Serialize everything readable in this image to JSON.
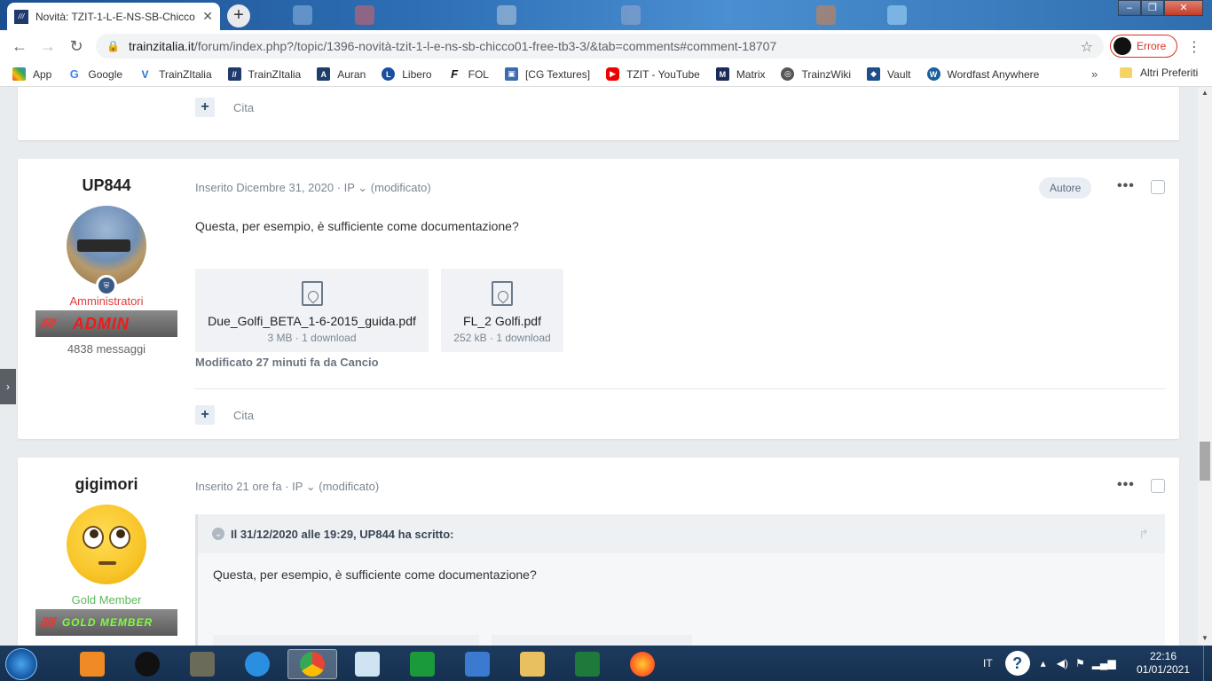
{
  "browser": {
    "tab_title": "Novità: TZIT-1-L-E-NS-SB-Chicco",
    "url_host": "trainzitalia.it",
    "url_path": "/forum/index.php?/topic/1396-novità-tzit-1-l-e-ns-sb-chicco01-free-tb3-3/&tab=comments#comment-18707",
    "profile_status": "Errore",
    "bookmarks": [
      "App",
      "Google",
      "TrainZItalia",
      "TrainZItalia",
      "Auran",
      "Libero",
      "FOL",
      "[CG Textures]",
      "TZIT - YouTube",
      "Matrix",
      "TrainzWiki",
      "Vault",
      "Wordfast Anywhere"
    ],
    "bookmarks_more": "»",
    "other_bookmarks": "Altri Preferiti"
  },
  "forum": {
    "quote_label": "Cita",
    "posts": [
      {
        "author": "UP844",
        "meta": "Inserito Dicembre 31, 2020 · IP ⌄ (modificato)",
        "author_badge": "Autore",
        "group": "Amministratori",
        "group_color": "#e03c3c",
        "rank_label": "ADMIN",
        "post_count": "4838 messaggi",
        "text": "Questa, per esempio, è sufficiente come documentazione?",
        "attachments": [
          {
            "name": "Due_Golfi_BETA_1-6-2015_guida.pdf",
            "info": "3 MB · 1 download"
          },
          {
            "name": "FL_2 Golfi.pdf",
            "info": "252 kB · 1 download"
          }
        ],
        "modified_note": "Modificato 27 minuti fa da Cancio"
      },
      {
        "author": "gigimori",
        "meta": "Inserito 21 ore fa · IP ⌄ (modificato)",
        "group": "Gold Member",
        "group_color": "#5cb85c",
        "rank_label": "GOLD MEMBER",
        "quote_header": "Il 31/12/2020 alle 19:29, UP844 ha scritto:",
        "quote_text": "Questa, per esempio, è sufficiente come documentazione?"
      }
    ]
  },
  "taskbar": {
    "language": "IT",
    "time": "22:16",
    "date": "01/01/2021"
  }
}
